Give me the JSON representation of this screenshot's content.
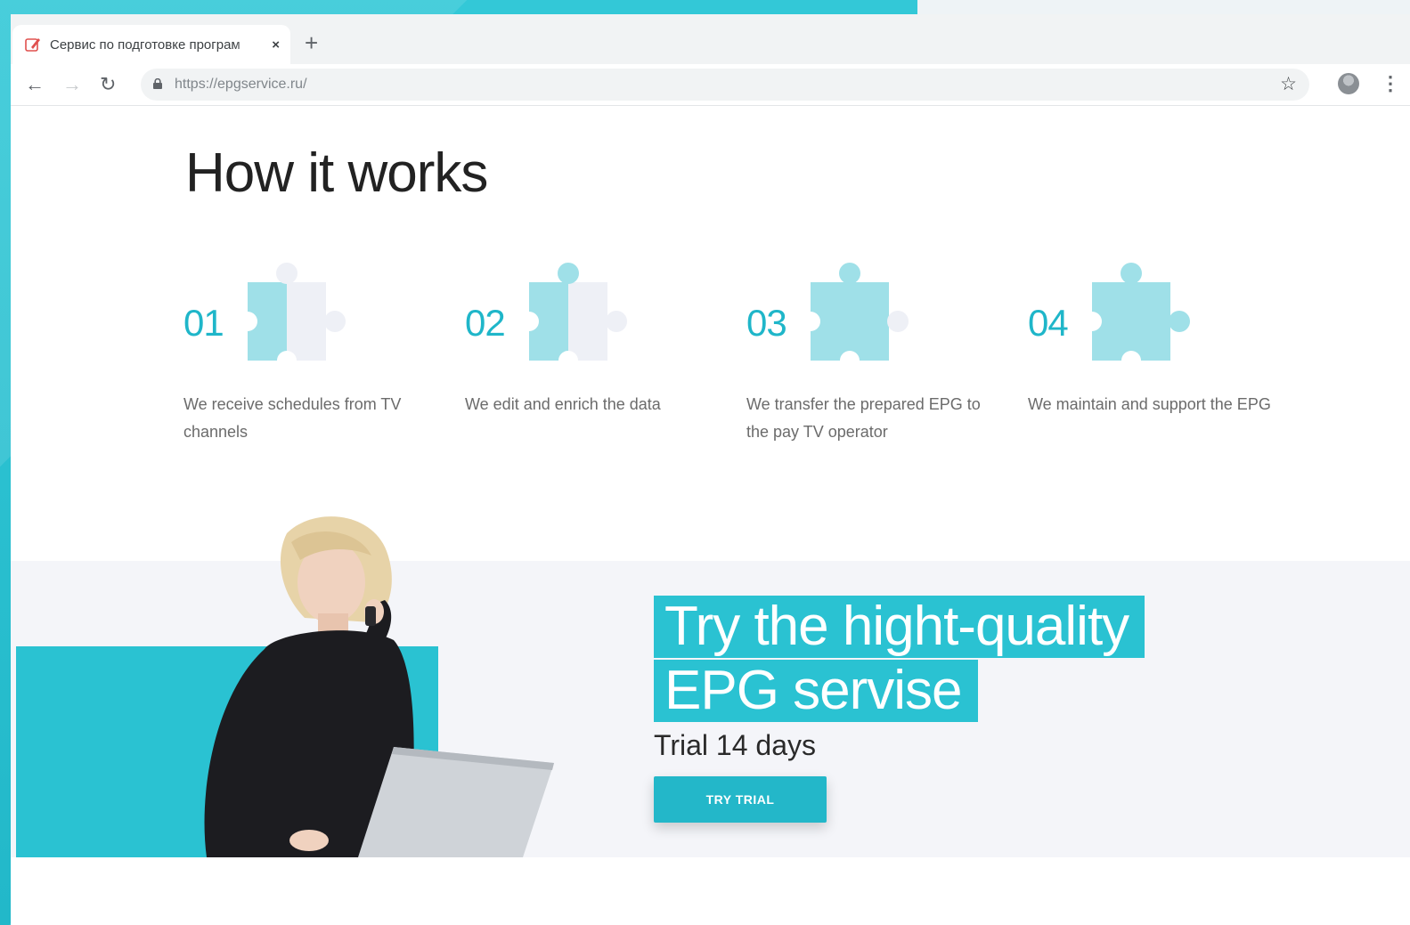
{
  "browser": {
    "tab_title": "Сервис по подготовке програм",
    "tab_close": "×",
    "new_tab": "+",
    "url": "https://epgservice.ru/",
    "icons": [
      "back-icon",
      "forward-icon",
      "reload-icon",
      "lock-icon",
      "star-icon",
      "profile-icon",
      "menu-icon"
    ]
  },
  "page": {
    "title": "How it works",
    "steps": [
      {
        "number": "01",
        "text": "We receive schedules from TV channels",
        "filled_pieces": 1
      },
      {
        "number": "02",
        "text": "We edit and enrich the data",
        "filled_pieces": 2
      },
      {
        "number": "03",
        "text": "We transfer the prepared EPG to the pay TV operator",
        "filled_pieces": 3
      },
      {
        "number": "04",
        "text": "We maintain and support the EPG",
        "filled_pieces": 4
      }
    ],
    "hero": {
      "title_line1": "Try the hight-quality",
      "title_line2": "EPG servise",
      "subtitle": "Trial 14 days",
      "button": "TRY TRIAL"
    }
  },
  "colors": {
    "accent": "#1fb6c9",
    "hero_block": "#2ac2d2",
    "puzzle_filled": "#9fe0e8",
    "puzzle_empty": "#eef0f6"
  }
}
